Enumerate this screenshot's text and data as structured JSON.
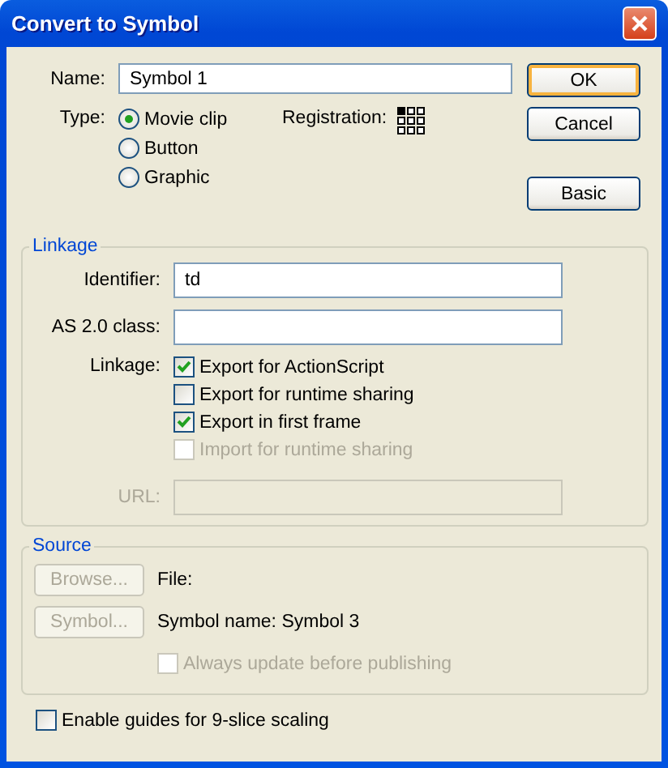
{
  "window": {
    "title": "Convert to Symbol"
  },
  "name": {
    "label": "Name:",
    "value": "Symbol 1"
  },
  "type": {
    "label": "Type:",
    "options": [
      {
        "label": "Movie clip",
        "selected": true
      },
      {
        "label": "Button",
        "selected": false
      },
      {
        "label": "Graphic",
        "selected": false
      }
    ]
  },
  "registration": {
    "label": "Registration:",
    "points": [
      {
        "selected": true
      },
      {
        "selected": false
      },
      {
        "selected": false
      },
      {
        "selected": false
      },
      {
        "selected": false
      },
      {
        "selected": false
      },
      {
        "selected": false
      },
      {
        "selected": false
      },
      {
        "selected": false
      }
    ]
  },
  "buttons": [
    {
      "label": "OK",
      "default": true
    },
    {
      "label": "Cancel",
      "default": false
    },
    {
      "label": "Basic",
      "default": false
    }
  ],
  "linkage": {
    "title": "Linkage",
    "identifier": {
      "label": "Identifier:",
      "value": "td"
    },
    "class": {
      "label": "AS 2.0 class:"
    },
    "label": "Linkage:",
    "options": [
      {
        "label": "Export for ActionScript",
        "checked": true,
        "disabled": false
      },
      {
        "label": "Export for runtime sharing",
        "checked": false,
        "disabled": false
      },
      {
        "label": "Export in first frame",
        "checked": true,
        "disabled": false
      },
      {
        "label": "Import for runtime sharing",
        "checked": false,
        "disabled": true
      }
    ],
    "url": {
      "label": "URL:",
      "disabled": true
    }
  },
  "source": {
    "title": "Source",
    "buttons": [
      {
        "label": "Browse...",
        "disabled": true
      },
      {
        "label": "Symbol...",
        "disabled": true
      }
    ],
    "file_label": "File:",
    "symbol_name": "Symbol name: Symbol 3",
    "always_update": {
      "label": "Always update before publishing",
      "checked": false,
      "disabled": true
    }
  },
  "guides": {
    "label": "Enable guides for 9-slice scaling",
    "checked": false
  }
}
